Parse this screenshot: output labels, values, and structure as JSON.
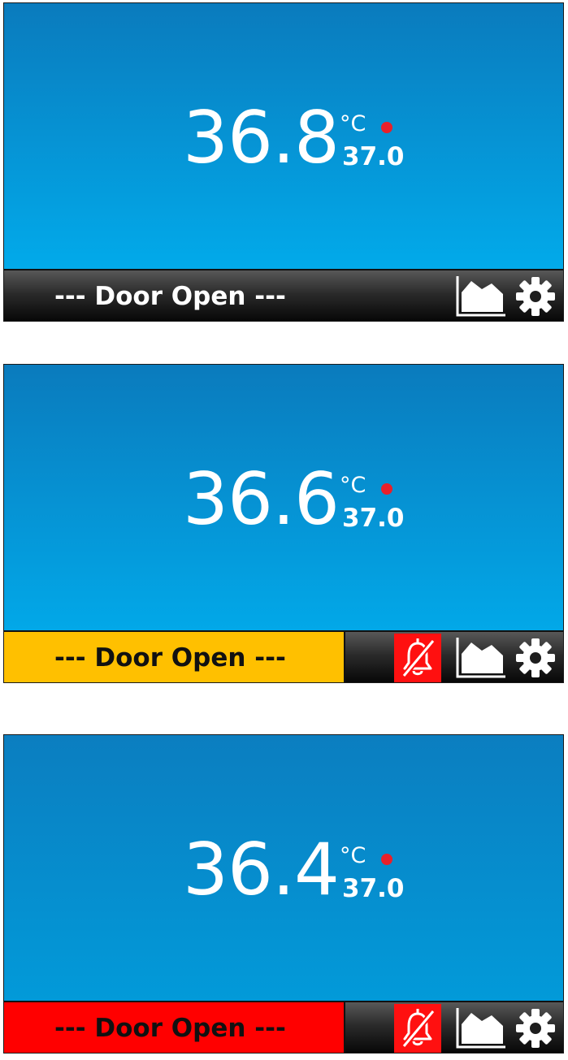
{
  "colors": {
    "dot": "#e8202a",
    "warning_bar": "#ffc000",
    "alarm_bar": "#ff0000",
    "mute_button": "#ff1010",
    "display_blue": "#0a7bbd"
  },
  "screens": [
    {
      "temperature": "36.8",
      "unit": "°C",
      "setpoint": "37.0",
      "status": "--- Door Open ---",
      "status_level": "normal",
      "alarm_mute_visible": false
    },
    {
      "temperature": "36.6",
      "unit": "°C",
      "setpoint": "37.0",
      "status": "--- Door Open ---",
      "status_level": "warning",
      "alarm_mute_visible": true
    },
    {
      "temperature": "36.4",
      "unit": "°C",
      "setpoint": "37.0",
      "status": "--- Door Open ---",
      "status_level": "alarm",
      "alarm_mute_visible": true
    }
  ],
  "icons": {
    "mute": "bell-slash-icon",
    "chart": "area-chart-icon",
    "settings": "gear-icon"
  }
}
